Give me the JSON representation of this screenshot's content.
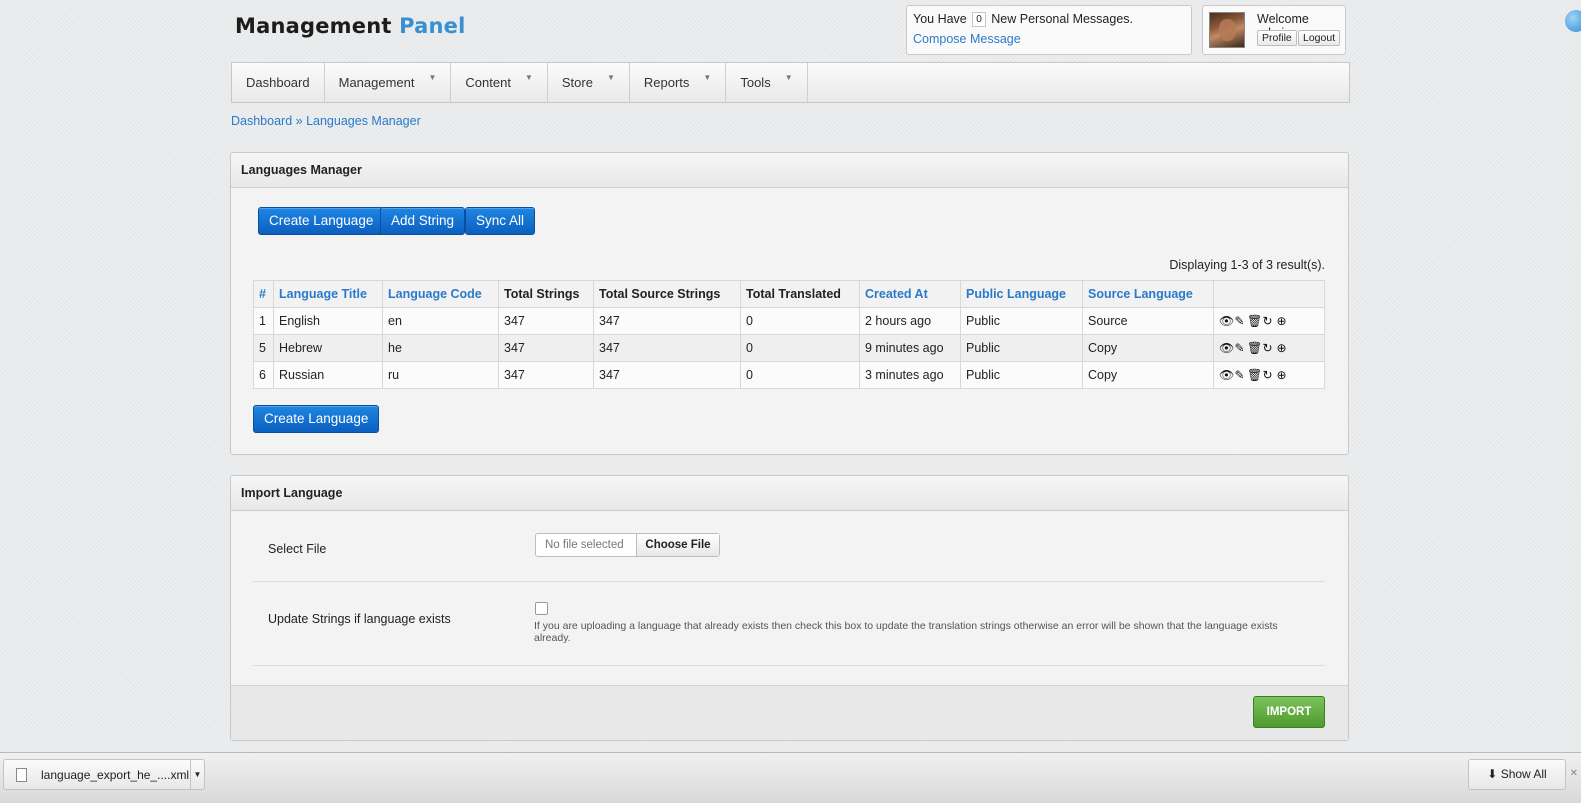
{
  "header": {
    "logo_part1": "Management",
    "logo_part2": "Panel",
    "messages": {
      "prefix": "You Have",
      "count": "0",
      "suffix": "New Personal Messages.",
      "compose": "Compose Message"
    },
    "user": {
      "welcome": "Welcome admin",
      "profile": "Profile",
      "logout": "Logout"
    }
  },
  "nav": {
    "items": [
      {
        "label": "Dashboard"
      },
      {
        "label": "Management"
      },
      {
        "label": "Content"
      },
      {
        "label": "Store"
      },
      {
        "label": "Reports"
      },
      {
        "label": "Tools"
      }
    ]
  },
  "breadcrumb": {
    "root": "Dashboard",
    "sep": "»",
    "current": "Languages Manager"
  },
  "languages_panel": {
    "title": "Languages Manager",
    "buttons": {
      "create": "Create Language",
      "add_string": "Add String",
      "sync_all": "Sync All",
      "create_bottom": "Create Language"
    },
    "displaying": "Displaying 1-3 of 3 result(s).",
    "columns": [
      "#",
      "Language Title",
      "Language Code",
      "Total Strings",
      "Total Source Strings",
      "Total Translated",
      "Created At",
      "Public Language",
      "Source Language",
      ""
    ],
    "rows": [
      [
        "1",
        "English",
        "en",
        "347",
        "347",
        "0",
        "2 hours ago",
        "Public",
        "Source"
      ],
      [
        "5",
        "Hebrew",
        "he",
        "347",
        "347",
        "0",
        "9 minutes ago",
        "Public",
        "Copy"
      ],
      [
        "6",
        "Russian",
        "ru",
        "347",
        "347",
        "0",
        "3 minutes ago",
        "Public",
        "Copy"
      ]
    ],
    "row_action_icons": [
      "view-icon",
      "edit-icon",
      "delete-icon",
      "sync-icon",
      "export-icon"
    ]
  },
  "import_panel": {
    "title": "Import Language",
    "select_file_label": "Select File",
    "file_placeholder": "No file selected",
    "choose_file": "Choose File",
    "update_label": "Update Strings if language exists",
    "update_help": "If you are uploading a language that already exists then check this box to update the translation strings otherwise an error will be shown that the language exists already.",
    "update_checked": false,
    "import_button": "IMPORT"
  },
  "download_bar": {
    "filename": "language_export_he_....xml",
    "show_all": "Show All"
  },
  "colors": {
    "link": "#2a7ac9",
    "primary_button": "#0b5fbf",
    "import_button": "#4f9a2e"
  }
}
